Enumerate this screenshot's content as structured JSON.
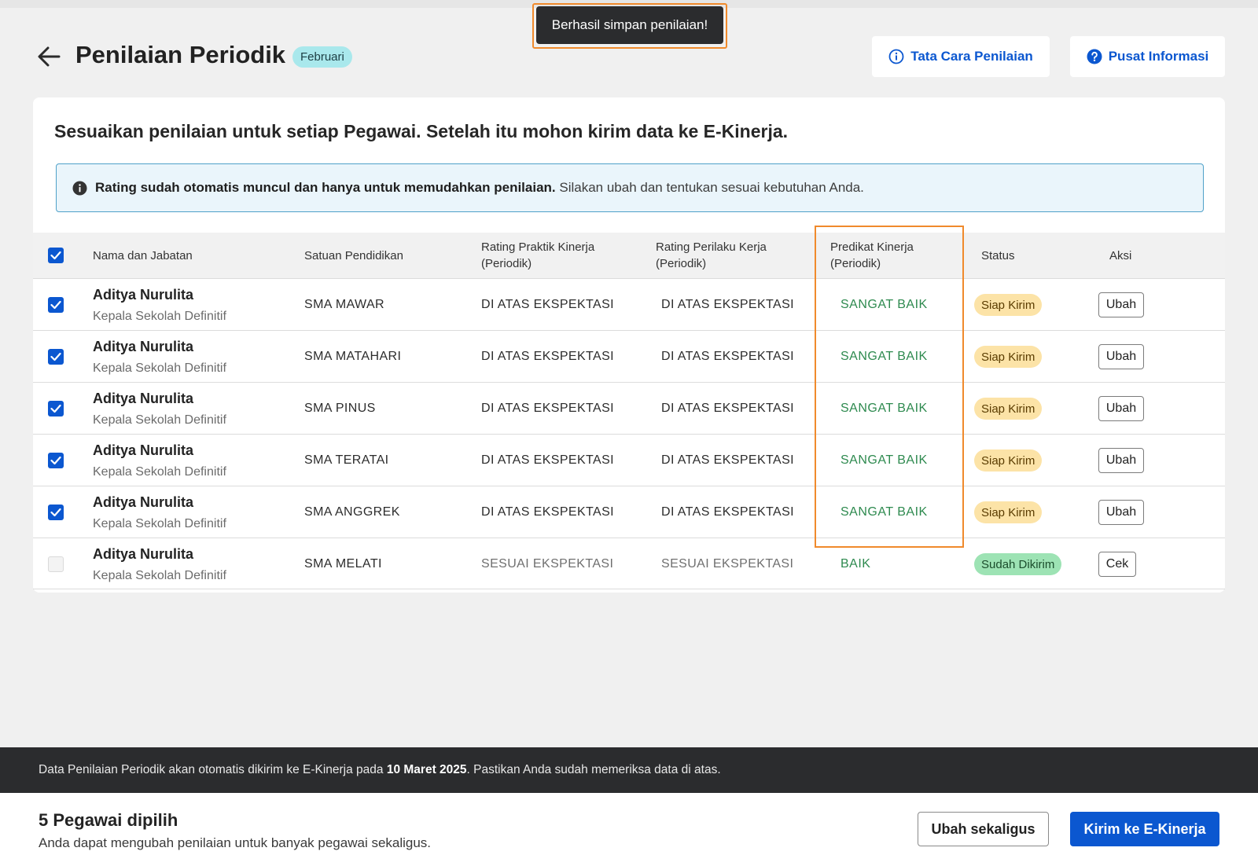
{
  "toast": {
    "message": "Berhasil simpan penilaian!"
  },
  "header": {
    "title": "Penilaian Periodik",
    "month": "Februari",
    "tata_cara_label": "Tata Cara Penilaian",
    "pusat_info_label": "Pusat Informasi"
  },
  "intro": "Sesuaikan penilaian untuk setiap Pegawai. Setelah itu mohon kirim data ke E-Kinerja.",
  "info": {
    "bold": "Rating sudah otomatis muncul dan hanya untuk memudahkan penilaian.",
    "rest": "Silakan ubah dan tentukan sesuai kebutuhan Anda."
  },
  "table": {
    "headers": {
      "nama": "Nama dan Jabatan",
      "satuan": "Satuan Pendidikan",
      "praktik_1": "Rating Praktik Kinerja",
      "praktik_2": "(Periodik)",
      "perilaku_1": "Rating Perilaku Kerja",
      "perilaku_2": "(Periodik)",
      "predikat_1": "Predikat Kinerja",
      "predikat_2": "(Periodik)",
      "status": "Status",
      "aksi": "Aksi"
    },
    "rows": [
      {
        "checked": true,
        "name": "Aditya Nurulita",
        "role": "Kepala Sekolah Definitif",
        "school": "SMA MAWAR",
        "praktik": "DI ATAS EKSPEKTASI",
        "perilaku": "DI ATAS EKSPEKTASI",
        "predikat": "SANGAT BAIK",
        "status": "Siap Kirim",
        "action": "Ubah"
      },
      {
        "checked": true,
        "name": "Aditya Nurulita",
        "role": "Kepala Sekolah Definitif",
        "school": "SMA MATAHARI",
        "praktik": "DI ATAS EKSPEKTASI",
        "perilaku": "DI ATAS EKSPEKTASI",
        "predikat": "SANGAT BAIK",
        "status": "Siap Kirim",
        "action": "Ubah"
      },
      {
        "checked": true,
        "name": "Aditya Nurulita",
        "role": "Kepala Sekolah Definitif",
        "school": "SMA PINUS",
        "praktik": "DI ATAS EKSPEKTASI",
        "perilaku": "DI ATAS EKSPEKTASI",
        "predikat": "SANGAT BAIK",
        "status": "Siap Kirim",
        "action": "Ubah"
      },
      {
        "checked": true,
        "name": "Aditya Nurulita",
        "role": "Kepala Sekolah Definitif",
        "school": "SMA TERATAI",
        "praktik": "DI ATAS EKSPEKTASI",
        "perilaku": "DI ATAS EKSPEKTASI",
        "predikat": "SANGAT BAIK",
        "status": "Siap Kirim",
        "action": "Ubah"
      },
      {
        "checked": true,
        "name": "Aditya Nurulita",
        "role": "Kepala Sekolah Definitif",
        "school": "SMA ANGGREK",
        "praktik": "DI ATAS EKSPEKTASI",
        "perilaku": "DI ATAS EKSPEKTASI",
        "predikat": "SANGAT BAIK",
        "status": "Siap Kirim",
        "action": "Ubah"
      },
      {
        "checked": false,
        "name": "Aditya Nurulita",
        "role": "Kepala Sekolah Definitif",
        "school": "SMA MELATI",
        "praktik": "SESUAI EKSPEKTASI",
        "perilaku": "SESUAI EKSPEKTASI",
        "predikat": "BAIK",
        "status": "Sudah Dikirim",
        "action": "Cek"
      }
    ]
  },
  "notice": {
    "pre": "Data Penilaian Periodik akan otomatis dikirim ke E-Kinerja pada",
    "date": "10 Maret 2025",
    "post": ". Pastikan Anda sudah memeriksa data di atas."
  },
  "footer": {
    "selected": "5 Pegawai dipilih",
    "hint": "Anda dapat mengubah penilaian untuk banyak pegawai sekaligus.",
    "bulk_edit": "Ubah sekaligus",
    "send": "Kirim ke E-Kinerja"
  },
  "colors": {
    "primary": "#0b57d0",
    "highlight": "#f08a2c",
    "ready": "#fce3a7",
    "sent": "#9de3b4",
    "good": "#2e8a4f"
  },
  "icons": {
    "back": "arrow-left-icon",
    "tata_cara": "info-circle-icon",
    "pusat_info": "question-circle-icon",
    "info_box": "info-filled-icon",
    "checkbox": "checkmark-icon"
  }
}
